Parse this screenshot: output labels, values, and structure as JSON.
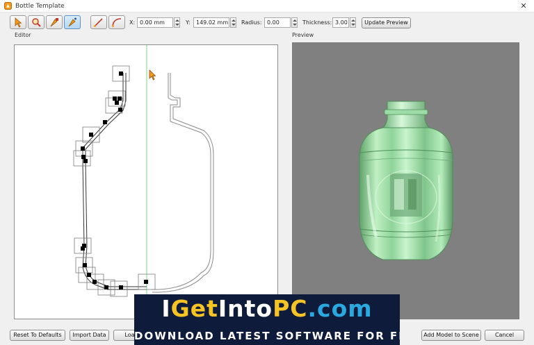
{
  "window": {
    "title": "Bottle Template",
    "close_glyph": "✕"
  },
  "toolbar": {
    "tools": [
      {
        "name": "select-arrow-icon"
      },
      {
        "name": "zoom-tool-icon"
      },
      {
        "name": "add-point-icon"
      },
      {
        "name": "move-point-icon",
        "active": true
      },
      {
        "name": "line-tool-icon"
      },
      {
        "name": "curve-tool-icon"
      }
    ],
    "x_label": "X:",
    "x_value": "0.00 mm",
    "y_label": "Y:",
    "y_value": "149.02 mm",
    "radius_label": "Radius:",
    "radius_value": "0.00",
    "thickness_label": "Thickness:",
    "thickness_value": "3.00",
    "update_preview": "Update Preview"
  },
  "editor": {
    "label": "Editor"
  },
  "preview": {
    "label": "Preview"
  },
  "bottom": {
    "reset": "Reset To Defaults",
    "import": "Import Data",
    "load": "Load",
    "add_model": "Add Model to Scene",
    "cancel": "Cancel"
  },
  "watermark": {
    "title_parts": [
      {
        "text": "I",
        "color": "#ffffff"
      },
      {
        "text": "Get",
        "color": "#f6c324"
      },
      {
        "text": "Into",
        "color": "#ffffff"
      },
      {
        "text": "PC",
        "color": "#f6c324"
      },
      {
        "text": ".com",
        "color": "#2aa9e0"
      }
    ],
    "subtitle": "DOWNLOAD LATEST SOFTWARE FOR FREE"
  },
  "colors": {
    "bottle_glass": "#9fe2a8",
    "accent_orange": "#f39a1c",
    "axis_green": "#7fd28a"
  }
}
